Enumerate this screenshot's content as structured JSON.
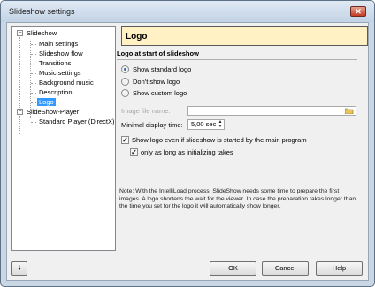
{
  "window": {
    "title": "Slideshow settings",
    "close_icon": "close-icon"
  },
  "tree": {
    "root1": "Slideshow",
    "root1_children": [
      "Main settings",
      "Slideshow flow",
      "Transitions",
      "Music settings",
      "Background music",
      "Description",
      "Logo"
    ],
    "root2": "SlideShow-Player",
    "root2_children": [
      "Standard Player (DirectX)"
    ]
  },
  "panel": {
    "title": "Logo"
  },
  "section": {
    "title": "Logo at start of slideshow"
  },
  "radios": {
    "standard": "Show standard logo",
    "dont": "Don't show logo",
    "custom": "Show custom logo"
  },
  "file": {
    "label": "Image file name:",
    "value": ""
  },
  "display_time": {
    "label": "Minimal display time:",
    "value": "5,00 sec"
  },
  "checks": {
    "even_if": "Show logo even if slideshow is started by the main program",
    "only_init": "only as long as initializing takes"
  },
  "note": "Note: With the IntelliLoad process, SlideShow needs some time to prepare the first images. A logo shortens the wait for the viewer.  In case the preparation takes longer than the time you set for the logo it will automatically show longer.",
  "buttons": {
    "ok": "OK",
    "cancel": "Cancel",
    "help": "Help"
  },
  "colors": {
    "header_bg": "#fff1c4",
    "selected": "#3399ff",
    "frame": "#c9d6e3"
  }
}
